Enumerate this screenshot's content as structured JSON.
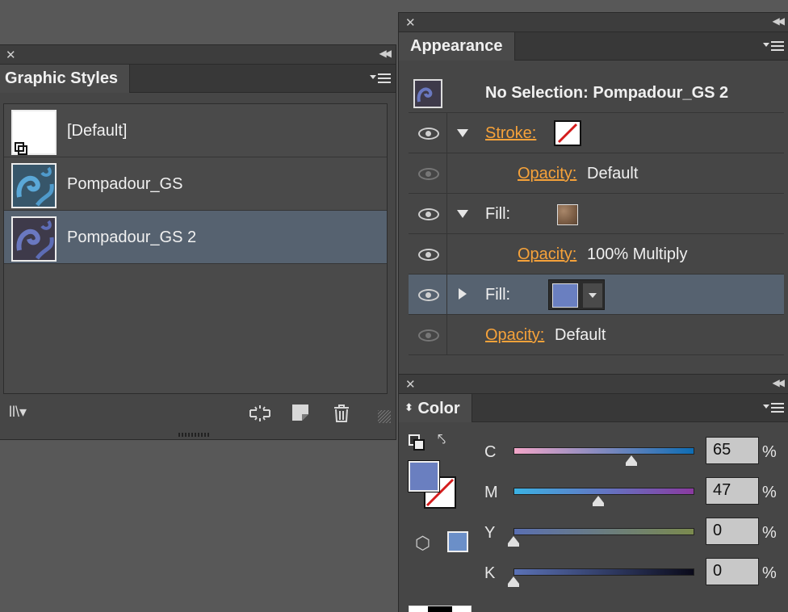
{
  "graphic_styles": {
    "title": "Graphic Styles",
    "styles": [
      {
        "name": "[Default]",
        "selected": false
      },
      {
        "name": "Pompadour_GS",
        "selected": false
      },
      {
        "name": "Pompadour_GS 2",
        "selected": true
      }
    ],
    "icons": [
      "library-menu-icon",
      "break-link-icon",
      "new-style-icon",
      "trash-icon"
    ]
  },
  "appearance": {
    "title": "Appearance",
    "header": "No Selection: Pompadour_GS 2",
    "rows": [
      {
        "label": "Stroke:",
        "type": "stroke"
      },
      {
        "label": "Opacity:",
        "value": "Default"
      },
      {
        "label": "Fill:",
        "type": "fill-texture"
      },
      {
        "label": "Opacity:",
        "value": "100% Multiply"
      },
      {
        "label": "Fill:",
        "type": "fill-blue"
      },
      {
        "label": "Opacity:",
        "value": "Default"
      }
    ]
  },
  "color": {
    "title": "Color",
    "fill_color": "#6a7fc0",
    "channels": [
      {
        "label": "C",
        "value": "65",
        "unit": "%"
      },
      {
        "label": "M",
        "value": "47",
        "unit": "%"
      },
      {
        "label": "Y",
        "value": "0",
        "unit": "%"
      },
      {
        "label": "K",
        "value": "0",
        "unit": "%"
      }
    ]
  }
}
